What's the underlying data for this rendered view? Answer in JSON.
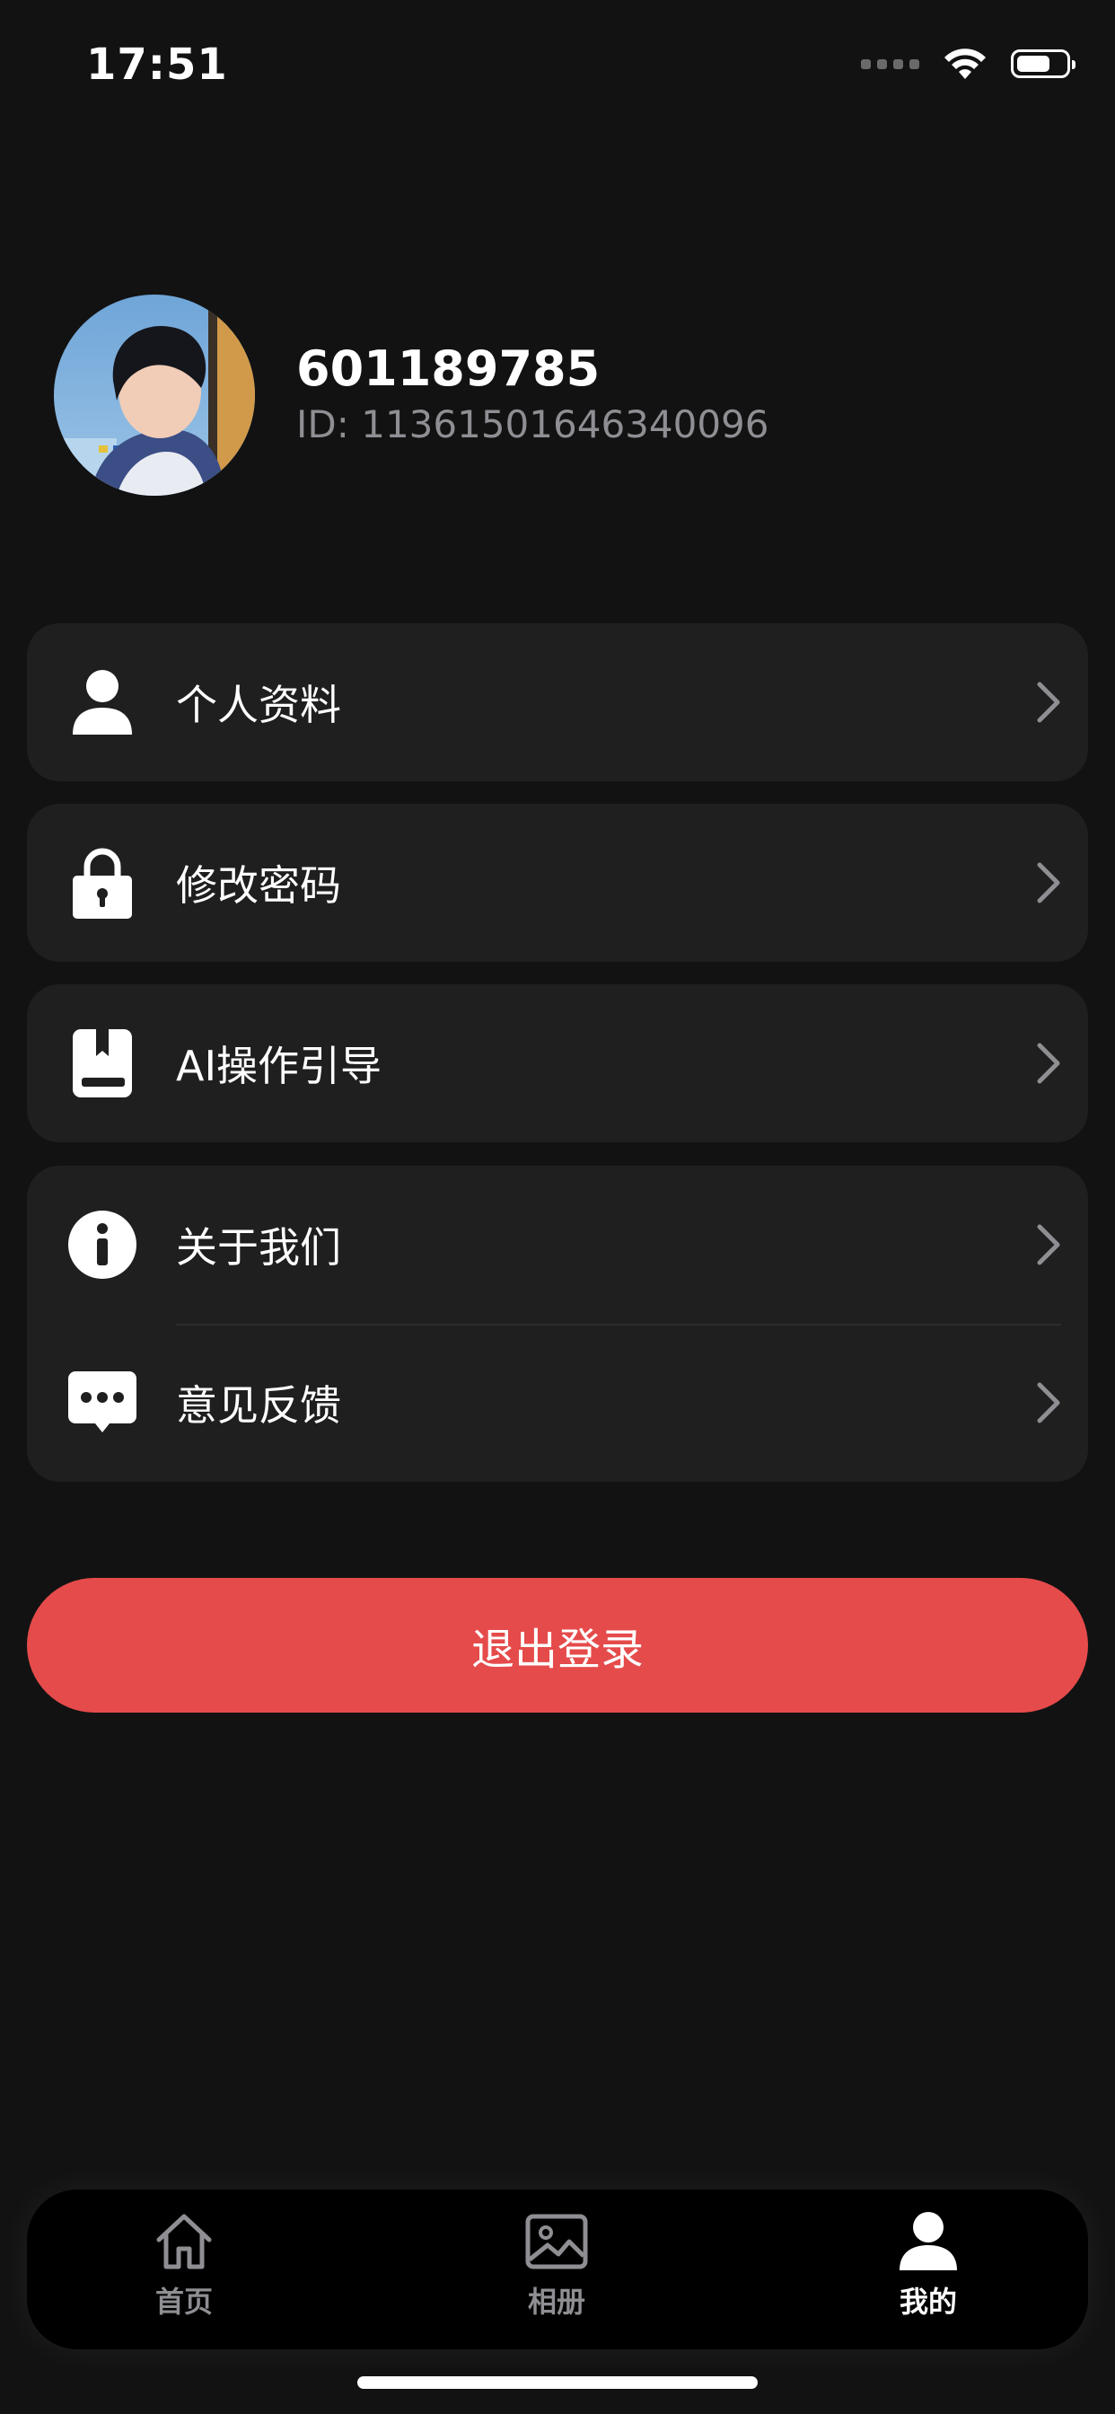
{
  "status_bar": {
    "time": "17:51",
    "battery_level": 0.7
  },
  "profile": {
    "name": "601189785",
    "id_text": "ID: 11361501646340096"
  },
  "menu": {
    "profile_info": {
      "label": "个人资料",
      "icon": "person-icon"
    },
    "change_password": {
      "label": "修改密码",
      "icon": "lock-icon"
    },
    "ai_guide": {
      "label": "AI操作引导",
      "icon": "book-icon"
    },
    "about_us": {
      "label": "关于我们",
      "icon": "info-icon"
    },
    "feedback": {
      "label": "意见反馈",
      "icon": "chat-icon"
    }
  },
  "logout": {
    "label": "退出登录",
    "color": "#e54b4b"
  },
  "tabbar": {
    "tabs": [
      {
        "label": "首页",
        "icon": "home-icon",
        "active": false
      },
      {
        "label": "相册",
        "icon": "image-icon",
        "active": false
      },
      {
        "label": "我的",
        "icon": "person-icon",
        "active": true
      }
    ]
  }
}
